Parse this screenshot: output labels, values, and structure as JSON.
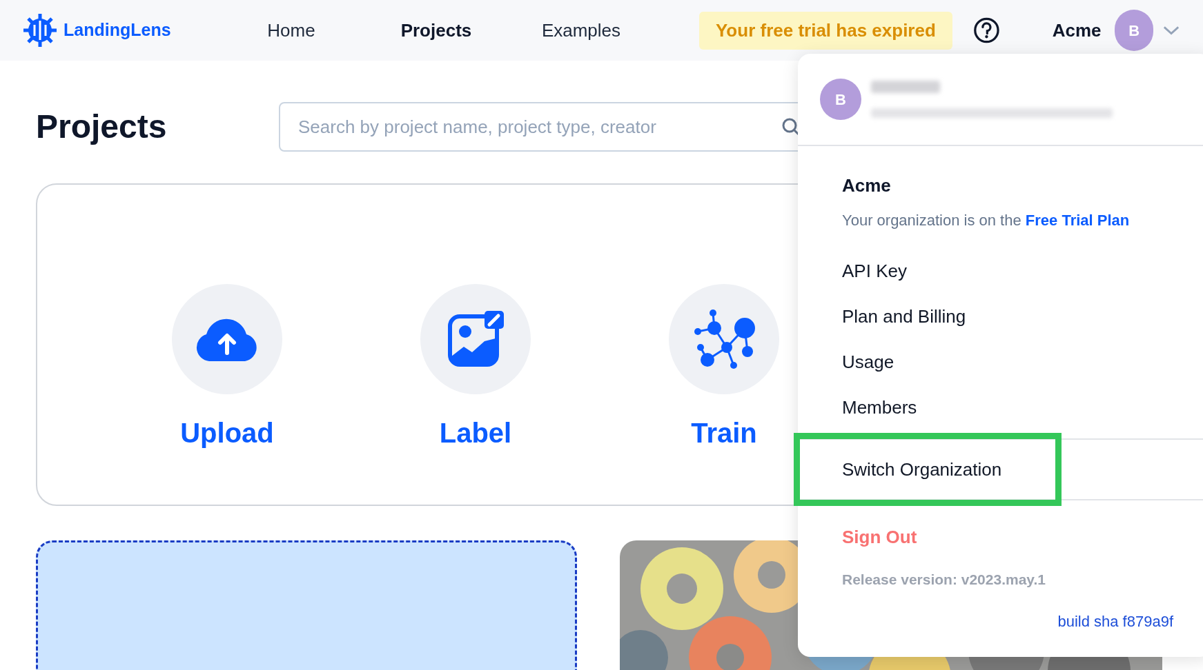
{
  "header": {
    "logo": "LandingLens",
    "nav": [
      {
        "label": "Home",
        "selected": false
      },
      {
        "label": "Projects",
        "selected": true
      },
      {
        "label": "Examples",
        "selected": false
      }
    ],
    "trial_banner": "Your free trial has expired",
    "org": "Acme",
    "avatar": "B"
  },
  "page": {
    "title": "Projects",
    "search": {
      "placeholder": "Search by project name, project type, creator"
    },
    "actions": [
      {
        "label": "Upload",
        "kind": "upload"
      },
      {
        "label": "Label",
        "kind": "label"
      },
      {
        "label": "Train",
        "kind": "train"
      }
    ],
    "project_cards": [
      {
        "kind": "new"
      },
      {
        "kind": "picture"
      }
    ]
  },
  "account_menu": {
    "avatar": "B",
    "org_name": "Acme",
    "plan_prefix": "Your organization is on the",
    "plan_link": "Free Trial Plan",
    "groups": [
      [
        {
          "label": "API Key",
          "highlighted": false
        },
        {
          "label": "Plan and Billing",
          "highlighted": false
        },
        {
          "label": "Usage",
          "highlighted": false
        },
        {
          "label": "Members",
          "highlighted": false
        }
      ],
      [
        {
          "label": "Switch Organization",
          "highlighted": true
        }
      ]
    ],
    "sign_out": "Sign Out",
    "release": "Release version: v2023.may.1",
    "build": "build sha f879a9f"
  }
}
